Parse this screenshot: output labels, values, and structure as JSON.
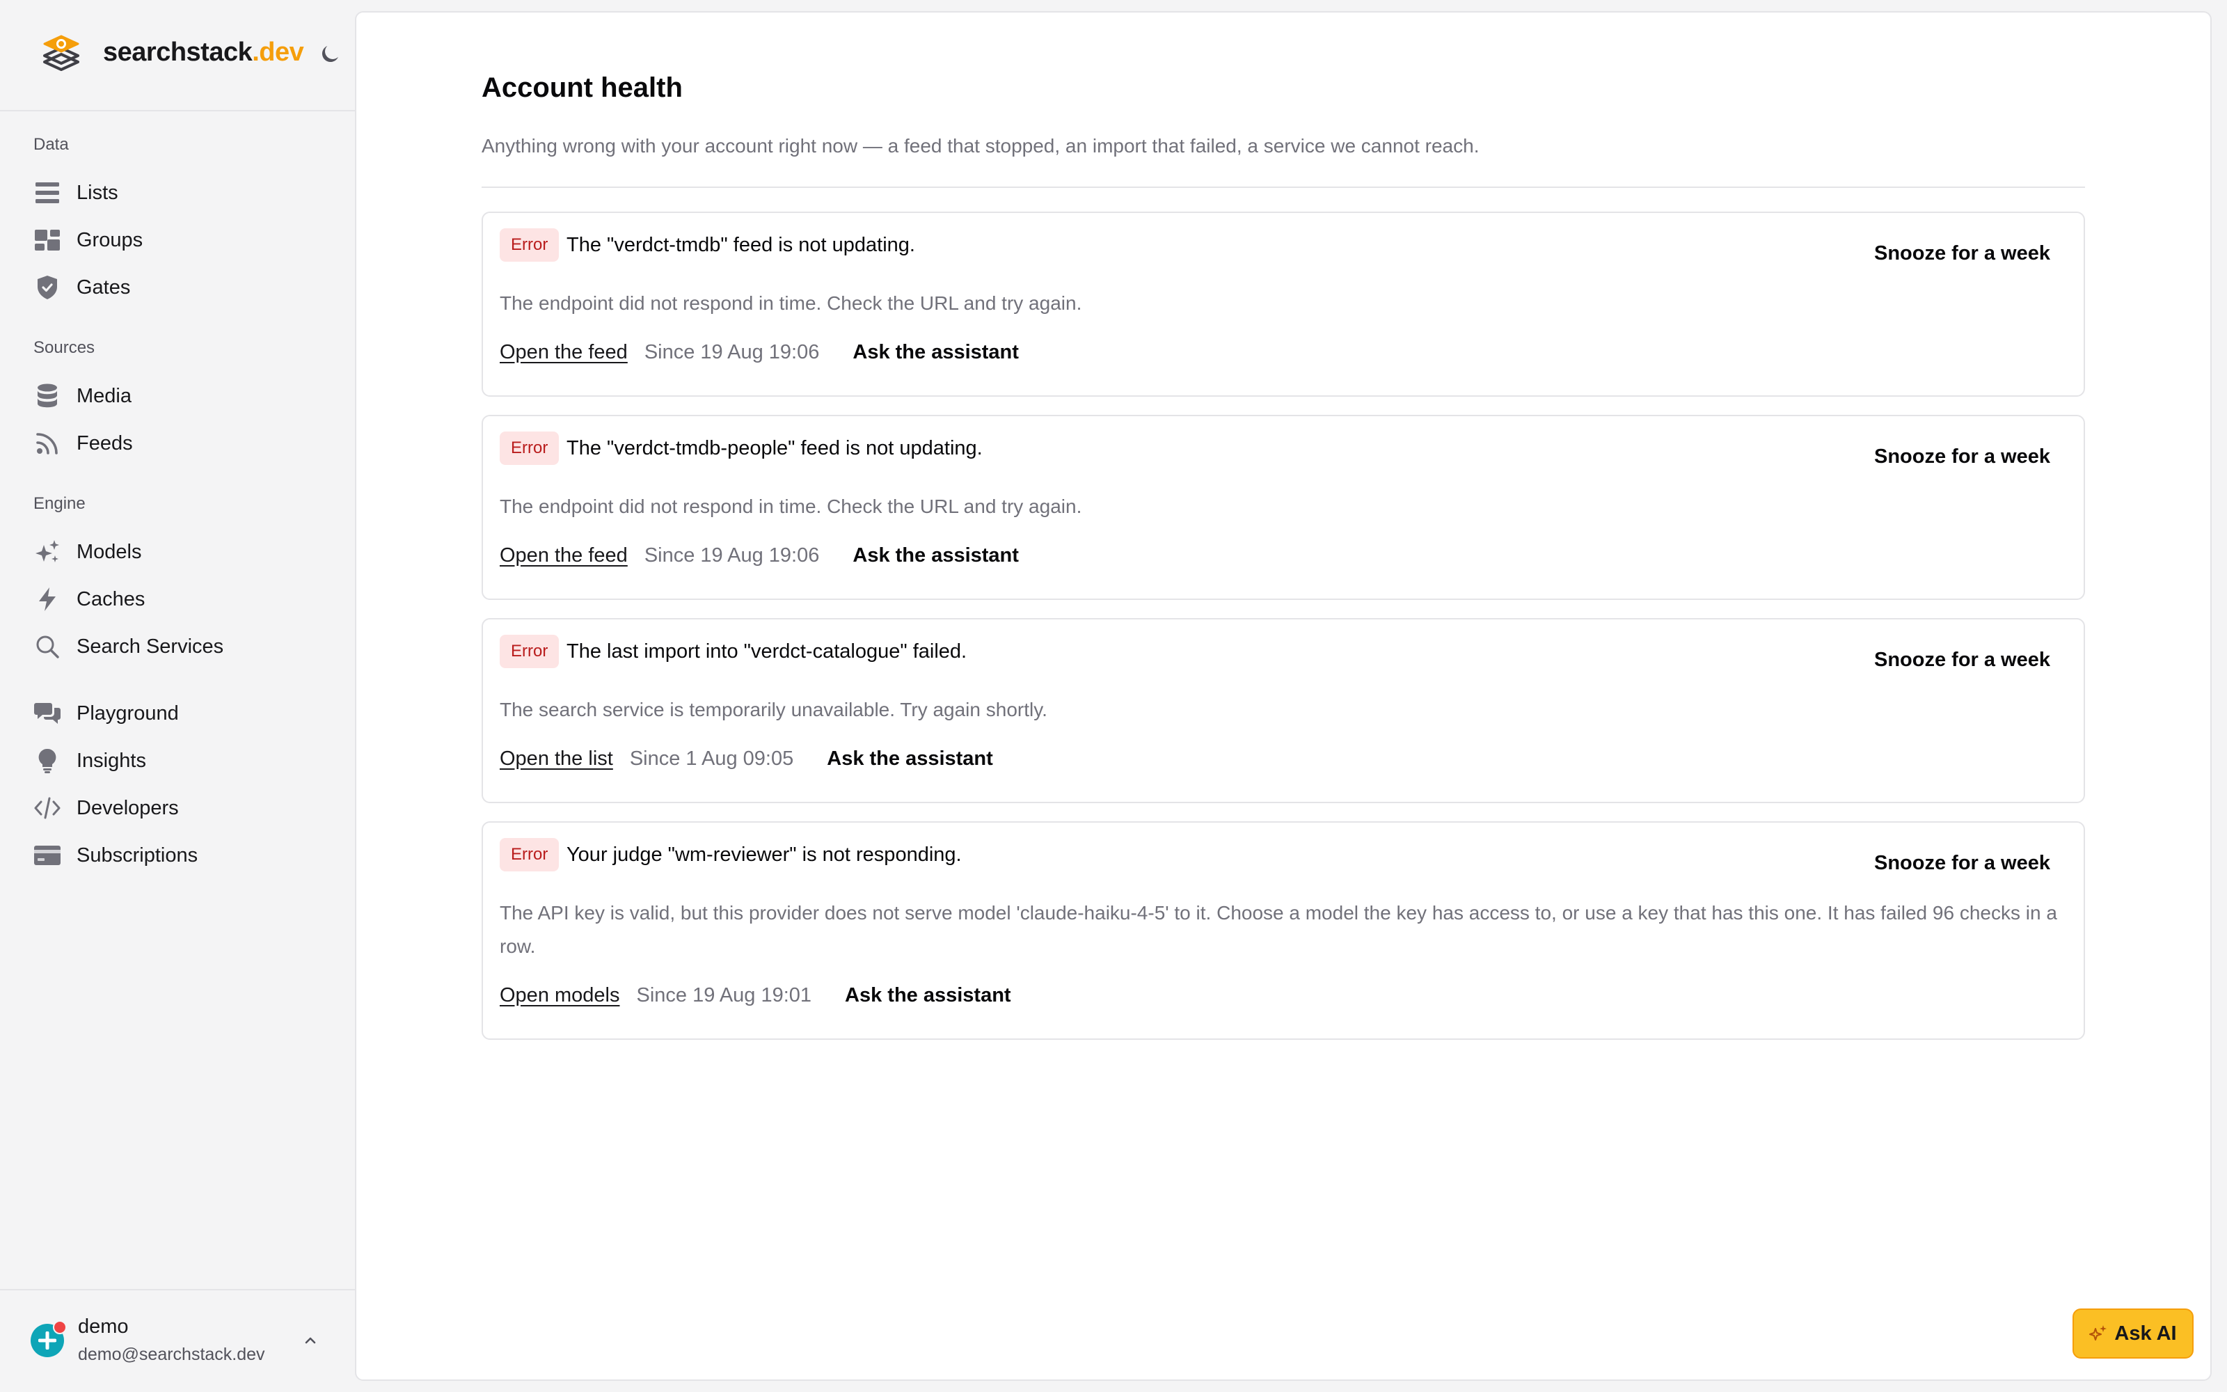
{
  "brand": {
    "name": "searchstack",
    "tld": ".dev"
  },
  "sidebar": {
    "sections": [
      {
        "label": "Data",
        "items": [
          {
            "label": "Lists",
            "icon": "list-icon"
          },
          {
            "label": "Groups",
            "icon": "groups-icon"
          },
          {
            "label": "Gates",
            "icon": "shield-icon"
          }
        ]
      },
      {
        "label": "Sources",
        "items": [
          {
            "label": "Media",
            "icon": "database-icon"
          },
          {
            "label": "Feeds",
            "icon": "rss-icon"
          }
        ]
      },
      {
        "label": "Engine",
        "items": [
          {
            "label": "Models",
            "icon": "sparkles-icon"
          },
          {
            "label": "Caches",
            "icon": "lightning-icon"
          },
          {
            "label": "Search Services",
            "icon": "search-icon"
          }
        ]
      },
      {
        "label": "",
        "items": [
          {
            "label": "Playground",
            "icon": "chat-icon"
          },
          {
            "label": "Insights",
            "icon": "lightbulb-icon"
          },
          {
            "label": "Developers",
            "icon": "code-icon"
          },
          {
            "label": "Subscriptions",
            "icon": "credit-card-icon"
          }
        ]
      }
    ]
  },
  "user": {
    "name": "demo",
    "email": "demo@searchstack.dev"
  },
  "page": {
    "title": "Account health",
    "subtitle": "Anything wrong with your account right now — a feed that stopped, an import that failed, a service we cannot reach."
  },
  "alerts": [
    {
      "badge": "Error",
      "title": "The \"verdct-tmdb\" feed is not updating.",
      "message": "The endpoint did not respond in time. Check the URL and try again.",
      "link": "Open the feed",
      "since": "Since 19 Aug 19:06",
      "ask": "Ask the assistant",
      "snooze": "Snooze for a week"
    },
    {
      "badge": "Error",
      "title": "The \"verdct-tmdb-people\" feed is not updating.",
      "message": "The endpoint did not respond in time. Check the URL and try again.",
      "link": "Open the feed",
      "since": "Since 19 Aug 19:06",
      "ask": "Ask the assistant",
      "snooze": "Snooze for a week"
    },
    {
      "badge": "Error",
      "title": "The last import into \"verdct-catalogue\" failed.",
      "message": "The search service is temporarily unavailable. Try again shortly.",
      "link": "Open the list",
      "since": "Since 1 Aug 09:05",
      "ask": "Ask the assistant",
      "snooze": "Snooze for a week"
    },
    {
      "badge": "Error",
      "title": "Your judge \"wm-reviewer\" is not responding.",
      "message": "The API key is valid, but this provider does not serve model 'claude-haiku-4-5' to it. Choose a model the key has access to, or use a key that has this one. It has failed 96 checks in a row.",
      "link": "Open models",
      "since": "Since 19 Aug 19:01",
      "ask": "Ask the assistant",
      "snooze": "Snooze for a week"
    }
  ],
  "ask_ai": {
    "label": "Ask AI"
  },
  "colors": {
    "accent": "#f59e0b",
    "error_bg": "#fde4e4",
    "error_text": "#b91c1c"
  }
}
